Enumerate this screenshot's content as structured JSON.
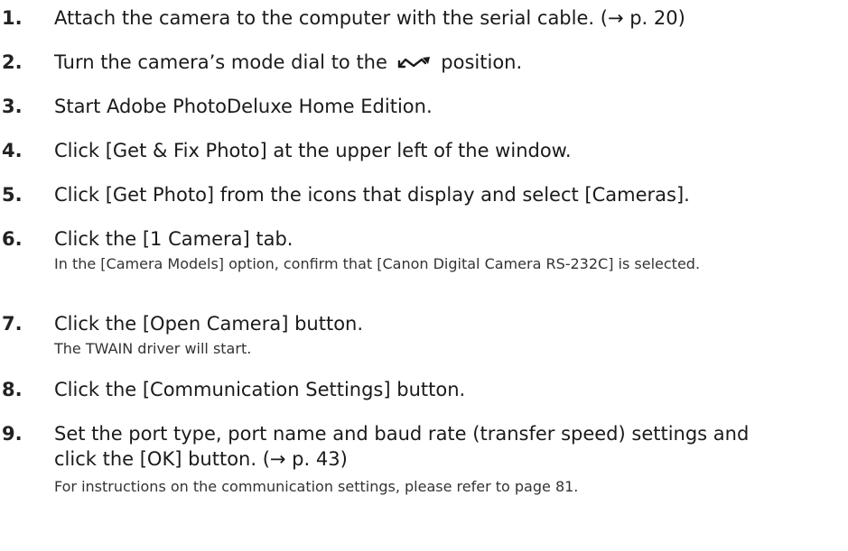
{
  "steps": [
    {
      "number": "1.",
      "text": "Attach the camera to the computer with the serial cable. (→ p. 20)"
    },
    {
      "number": "2.",
      "text_before": "Turn the camera’s mode dial to the",
      "icon": "pc-connection-icon",
      "text_after": "position."
    },
    {
      "number": "3.",
      "text": "Start Adobe PhotoDeluxe Home Edition."
    },
    {
      "number": "4.",
      "text": "Click [Get & Fix Photo] at the upper left of the window."
    },
    {
      "number": "5.",
      "text": "Click [Get Photo] from the icons that display and select [Cameras]."
    },
    {
      "number": "6.",
      "text": "Click the [1 Camera] tab.",
      "note": "In the [Camera Models] option, confirm that [Canon Digital Camera RS-232C] is selected."
    },
    {
      "number": "7.",
      "text": "Click the [Open Camera] button.",
      "note": "The TWAIN driver will start."
    },
    {
      "number": "8.",
      "text": "Click the [Communication Settings] button."
    },
    {
      "number": "9.",
      "text": "Set the port type, port name and baud rate (transfer speed) settings and click the [OK] button. (→ p. 43)",
      "note": "For instructions on the communication settings, please refer to page 81."
    }
  ]
}
